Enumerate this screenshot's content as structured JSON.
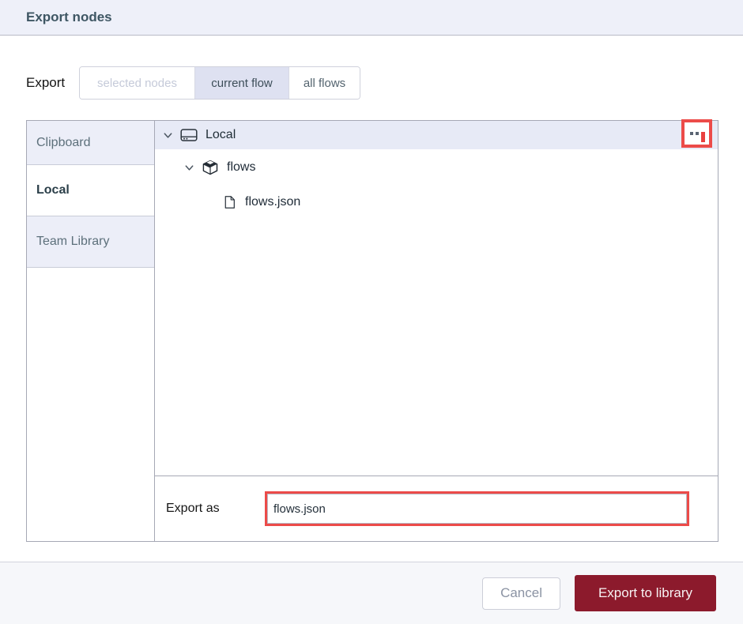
{
  "dialog": {
    "title": "Export nodes"
  },
  "export_row": {
    "label": "Export",
    "options": [
      {
        "label": "selected nodes",
        "state": "disabled"
      },
      {
        "label": "current flow",
        "state": "selected"
      },
      {
        "label": "all flows",
        "state": "normal"
      }
    ]
  },
  "library": {
    "tabs": [
      {
        "label": "Clipboard",
        "active": false
      },
      {
        "label": "Local",
        "active": true
      },
      {
        "label": "Team Library",
        "active": false
      }
    ],
    "tree": [
      {
        "label": "Local",
        "icon": "hard-drive-icon",
        "level": 0,
        "expanded": true,
        "selected": true
      },
      {
        "label": "flows",
        "icon": "package-icon",
        "level": 1,
        "expanded": true,
        "selected": false
      },
      {
        "label": "flows.json",
        "icon": "file-icon",
        "level": 2,
        "expanded": false,
        "selected": false
      }
    ],
    "menu_button": {
      "icon": "ellipsis-icon"
    },
    "filename": {
      "label": "Export as",
      "value": "flows.json"
    }
  },
  "footer": {
    "cancel_label": "Cancel",
    "submit_label": "Export to library"
  },
  "colors": {
    "annotation_red": "#ec4b49",
    "primary_button": "#8c1a2c",
    "selected_segment": "#dee1f1",
    "header_bg": "#eef0f9",
    "tree_header_bg": "#e7eaf6",
    "tab_bg": "#eceef8",
    "footer_bg": "#f6f7fa"
  }
}
